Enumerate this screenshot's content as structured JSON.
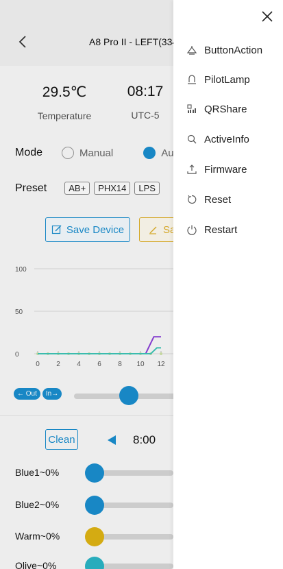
{
  "header": {
    "title": "A8 Pro II - LEFT(334"
  },
  "stats": [
    {
      "value": "29.5℃",
      "label": "Temperature"
    },
    {
      "value": "08:17",
      "label": "UTC-5"
    }
  ],
  "mode": {
    "label": "Mode",
    "options": [
      "Manual",
      "Au"
    ]
  },
  "preset": {
    "label": "Preset",
    "chips": [
      "AB+",
      "PHX14",
      "LPS"
    ]
  },
  "actions": {
    "save_device": "Save Device",
    "save_other": "Sa"
  },
  "chart_data": {
    "type": "line",
    "ylim": [
      0,
      100
    ],
    "yticks": [
      "0",
      "50",
      "100"
    ],
    "xticks": [
      "0",
      "2",
      "4",
      "6",
      "8",
      "10",
      "12"
    ],
    "xlim": [
      0,
      24
    ],
    "series": [
      {
        "color": "#8b3fd9",
        "x": [
          0,
          10.5,
          11.3,
          12.0
        ],
        "y": [
          0,
          0,
          20,
          20
        ]
      },
      {
        "color": "#3fc7b8",
        "x": [
          0,
          11.0,
          11.6,
          12.0
        ],
        "y": [
          0,
          0,
          7,
          7
        ]
      }
    ]
  },
  "io": {
    "out_label": "← Out",
    "in_label": "In→",
    "slider_value": 0.4
  },
  "clean": {
    "label": "Clean"
  },
  "time": {
    "value": "8:00"
  },
  "channels": [
    {
      "label": "Blue1~0%",
      "value": 0,
      "color": "#1a8fd0"
    },
    {
      "label": "Blue2~0%",
      "value": 0,
      "color": "#1a8fd0"
    },
    {
      "label": "Warm~0%",
      "value": 0,
      "color": "#e0b514"
    },
    {
      "label": "Olive~0%",
      "value": 0,
      "color": "#2bb6c7"
    }
  ],
  "menu": {
    "items": [
      {
        "label": "ButtonAction",
        "icon": "bell-icon"
      },
      {
        "label": "PilotLamp",
        "icon": "lamp-icon"
      },
      {
        "label": "QRShare",
        "icon": "qr-share-icon"
      },
      {
        "label": "ActiveInfo",
        "icon": "search-icon"
      },
      {
        "label": "Firmware",
        "icon": "upload-icon"
      },
      {
        "label": "Reset",
        "icon": "reset-icon"
      },
      {
        "label": "Restart",
        "icon": "power-icon"
      }
    ]
  }
}
